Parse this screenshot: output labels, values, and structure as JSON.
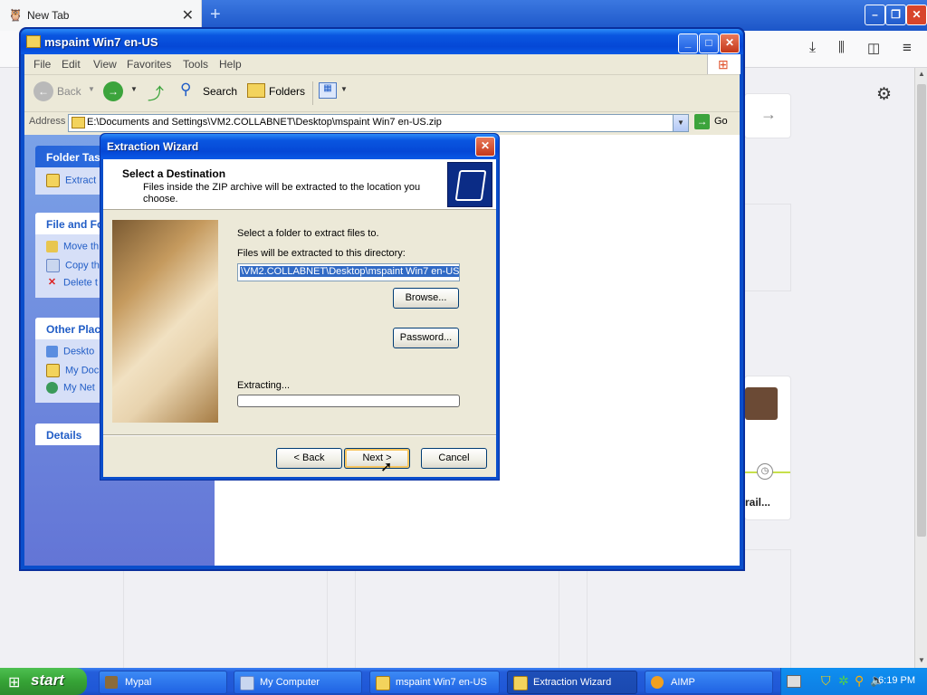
{
  "firefox": {
    "tab_title": "New Tab",
    "card_text": "rail..."
  },
  "explorer": {
    "title": "mspaint Win7 en-US",
    "menu": [
      "File",
      "Edit",
      "View",
      "Favorites",
      "Tools",
      "Help"
    ],
    "toolbar": {
      "back": "Back",
      "search": "Search",
      "folders": "Folders"
    },
    "address_label": "Address",
    "address_value": "E:\\Documents and Settings\\VM2.COLLABNET\\Desktop\\mspaint Win7 en-US.zip",
    "go_label": "Go",
    "left_pane": {
      "folder_tasks": {
        "title": "Folder Tas",
        "items": [
          "Extract"
        ]
      },
      "file_folder": {
        "title": "File and Fo",
        "items": [
          "Move th",
          "Copy th",
          "Delete t"
        ]
      },
      "other_places": {
        "title": "Other Plac",
        "items": [
          "Deskto",
          "My Doc",
          "My Net"
        ]
      },
      "details": {
        "title": "Details"
      }
    }
  },
  "wizard": {
    "title": "Extraction Wizard",
    "heading": "Select a Destination",
    "description": "Files inside the ZIP archive will be extracted to the location you choose.",
    "select_label": "Select a folder to extract files to.",
    "dir_label": "Files will be extracted to this directory:",
    "dir_value": "\\VM2.COLLABNET\\Desktop\\mspaint Win7 en-US",
    "browse": "Browse...",
    "password": "Password...",
    "extracting": "Extracting...",
    "progress": 0,
    "back": "< Back",
    "next": "Next >",
    "cancel": "Cancel"
  },
  "taskbar": {
    "start": "start",
    "tasks": [
      {
        "label": "Mypal",
        "icon": "mypal-icon",
        "active": false
      },
      {
        "label": "My Computer",
        "icon": "computer-icon",
        "active": false
      },
      {
        "label": "mspaint Win7 en-US",
        "icon": "zip-folder-icon",
        "active": false
      },
      {
        "label": "Extraction Wizard",
        "icon": "folder-icon",
        "active": true
      },
      {
        "label": "AIMP",
        "icon": "aimp-icon",
        "active": false
      }
    ],
    "clock": "6:19 PM"
  }
}
